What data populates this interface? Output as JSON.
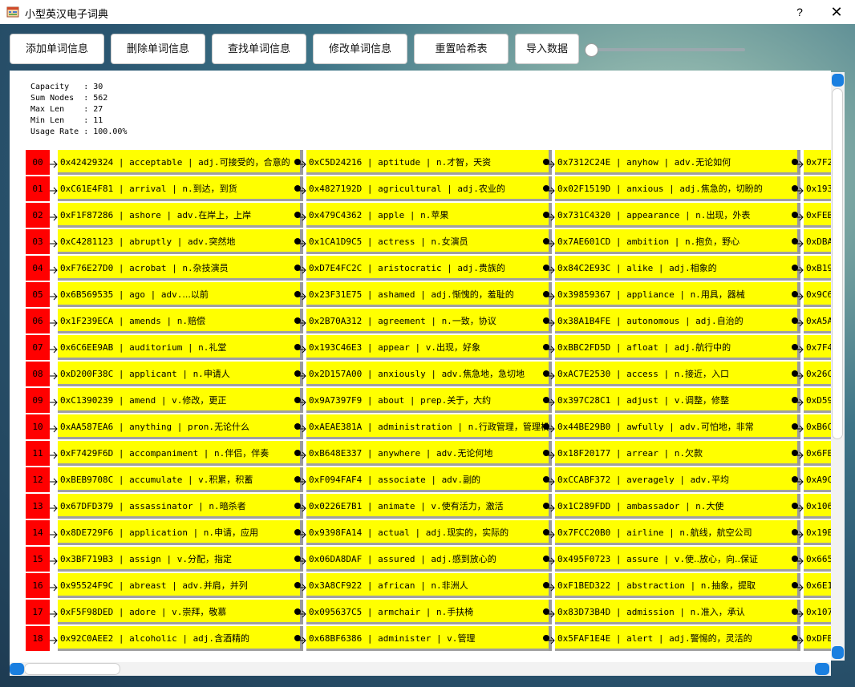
{
  "window": {
    "title": "小型英汉电子词典",
    "help": "?",
    "close": "✕"
  },
  "toolbar": {
    "buttons": [
      "添加单词信息",
      "删除单词信息",
      "查找单词信息",
      "修改单词信息",
      "重置哈希表",
      "导入数据"
    ],
    "slider_value": 0
  },
  "stats": {
    "capacity": "Capacity   : 30",
    "sum_nodes": "Sum Nodes  : 562",
    "max_len": "Max Len    : 27",
    "min_len": "Min Len    : 11",
    "usage_rate": "Usage Rate : 100.00%"
  },
  "colors": {
    "index_bg": "#ff0000",
    "cell_bg": "#ffff00",
    "accent": "#1a7fe0"
  },
  "rows": [
    {
      "idx": "00",
      "cells": [
        {
          "addr": "0x42429324",
          "word": "acceptable",
          "pos": "adj.",
          "meaning": "可接受的，合意的"
        },
        {
          "addr": "0xC5D24216",
          "word": "aptitude",
          "pos": "n.",
          "meaning": "才智，天资"
        },
        {
          "addr": "0x7312C24E",
          "word": "anyhow",
          "pos": "adv.",
          "meaning": "无论如何"
        },
        {
          "addr": "0x7F2",
          "word": "",
          "pos": "",
          "meaning": ""
        }
      ]
    },
    {
      "idx": "01",
      "cells": [
        {
          "addr": "0xC61E4F81",
          "word": "arrival",
          "pos": "n.",
          "meaning": "到达，到货"
        },
        {
          "addr": "0x4827192D",
          "word": "agricultural",
          "pos": "adj.",
          "meaning": "农业的"
        },
        {
          "addr": "0x02F1519D",
          "word": "anxious",
          "pos": "adj.",
          "meaning": "焦急的，切盼的"
        },
        {
          "addr": "0x193",
          "word": "",
          "pos": "",
          "meaning": ""
        }
      ]
    },
    {
      "idx": "02",
      "cells": [
        {
          "addr": "0xF1F87286",
          "word": "ashore",
          "pos": "adv.",
          "meaning": "在岸上，上岸"
        },
        {
          "addr": "0x479C4362",
          "word": "apple",
          "pos": "n.",
          "meaning": "苹果"
        },
        {
          "addr": "0x731C4320",
          "word": "appearance",
          "pos": "n.",
          "meaning": "出现，外表"
        },
        {
          "addr": "0xFEB",
          "word": "",
          "pos": "",
          "meaning": ""
        }
      ]
    },
    {
      "idx": "03",
      "cells": [
        {
          "addr": "0xC4281123",
          "word": "abruptly",
          "pos": "adv.",
          "meaning": "突然地"
        },
        {
          "addr": "0x1CA1D9C5",
          "word": "actress",
          "pos": "n.",
          "meaning": "女演员"
        },
        {
          "addr": "0x7AE601CD",
          "word": "ambition",
          "pos": "n.",
          "meaning": "抱负，野心"
        },
        {
          "addr": "0xDBA",
          "word": "",
          "pos": "",
          "meaning": ""
        }
      ]
    },
    {
      "idx": "04",
      "cells": [
        {
          "addr": "0xF76E27D0",
          "word": "acrobat",
          "pos": "n.",
          "meaning": "杂技演员"
        },
        {
          "addr": "0xD7E4FC2C",
          "word": "aristocratic",
          "pos": "adj.",
          "meaning": "贵族的"
        },
        {
          "addr": "0x84C2E93C",
          "word": "alike",
          "pos": "adj.",
          "meaning": "相象的"
        },
        {
          "addr": "0xB19",
          "word": "",
          "pos": "",
          "meaning": ""
        }
      ]
    },
    {
      "idx": "05",
      "cells": [
        {
          "addr": "0x6B569535",
          "word": "ago",
          "pos": "adv.",
          "meaning": "...以前"
        },
        {
          "addr": "0x23F31E75",
          "word": "ashamed",
          "pos": "adj.",
          "meaning": "惭愧的，羞耻的"
        },
        {
          "addr": "0x39859367",
          "word": "appliance",
          "pos": "n.",
          "meaning": "用具，器械"
        },
        {
          "addr": "0x9C6",
          "word": "",
          "pos": "",
          "meaning": ""
        }
      ]
    },
    {
      "idx": "06",
      "cells": [
        {
          "addr": "0x1F239ECA",
          "word": "amends",
          "pos": "n.",
          "meaning": "赔偿"
        },
        {
          "addr": "0x2B70A312",
          "word": "agreement",
          "pos": "n.",
          "meaning": "一致，协议"
        },
        {
          "addr": "0x38A1B4FE",
          "word": "autonomous",
          "pos": "adj.",
          "meaning": "自治的"
        },
        {
          "addr": "0xA5A",
          "word": "",
          "pos": "",
          "meaning": ""
        }
      ]
    },
    {
      "idx": "07",
      "cells": [
        {
          "addr": "0x6C6EE9AB",
          "word": "auditorium",
          "pos": "n.",
          "meaning": "礼堂"
        },
        {
          "addr": "0x193C46E3",
          "word": "appear",
          "pos": "v.",
          "meaning": "出现，好象"
        },
        {
          "addr": "0xBBC2FD5D",
          "word": "afloat",
          "pos": "adj.",
          "meaning": "航行中的"
        },
        {
          "addr": "0x7F4",
          "word": "",
          "pos": "",
          "meaning": ""
        }
      ]
    },
    {
      "idx": "08",
      "cells": [
        {
          "addr": "0xD200F38C",
          "word": "applicant",
          "pos": "n.",
          "meaning": "申请人"
        },
        {
          "addr": "0x2D157A00",
          "word": "anxiously",
          "pos": "adv.",
          "meaning": "焦急地，急切地"
        },
        {
          "addr": "0xAC7E2530",
          "word": "access",
          "pos": "n.",
          "meaning": "接近，入口"
        },
        {
          "addr": "0x26C",
          "word": "",
          "pos": "",
          "meaning": ""
        }
      ]
    },
    {
      "idx": "09",
      "cells": [
        {
          "addr": "0xC1390239",
          "word": "amend",
          "pos": "v.",
          "meaning": "修改，更正"
        },
        {
          "addr": "0x9A7397F9",
          "word": "about",
          "pos": "prep.",
          "meaning": "关于，大约"
        },
        {
          "addr": "0x397C28C1",
          "word": "adjust",
          "pos": "v.",
          "meaning": "调整，修整"
        },
        {
          "addr": "0xD59",
          "word": "",
          "pos": "",
          "meaning": ""
        }
      ]
    },
    {
      "idx": "10",
      "cells": [
        {
          "addr": "0xAA587EA6",
          "word": "anything",
          "pos": "pron.",
          "meaning": "无论什么"
        },
        {
          "addr": "0xAEAE381A",
          "word": "administration",
          "pos": "n.",
          "meaning": "行政管理，管理机关"
        },
        {
          "addr": "0x44BE29B0",
          "word": "awfully",
          "pos": "adv.",
          "meaning": "可怕地，非常"
        },
        {
          "addr": "0xB6C",
          "word": "",
          "pos": "",
          "meaning": ""
        }
      ]
    },
    {
      "idx": "11",
      "cells": [
        {
          "addr": "0xF7429F6D",
          "word": "accompaniment",
          "pos": "n.",
          "meaning": "伴侣，伴奏"
        },
        {
          "addr": "0xB648E337",
          "word": "anywhere",
          "pos": "adv.",
          "meaning": "无论何地"
        },
        {
          "addr": "0x18F20177",
          "word": "arrear",
          "pos": "n.",
          "meaning": "欠款"
        },
        {
          "addr": "0x6FE",
          "word": "",
          "pos": "",
          "meaning": ""
        }
      ]
    },
    {
      "idx": "12",
      "cells": [
        {
          "addr": "0xBEB9708C",
          "word": "accumulate",
          "pos": "v.",
          "meaning": "积累，积蓄"
        },
        {
          "addr": "0xF094FAF4",
          "word": "associate",
          "pos": "adv.",
          "meaning": "副的"
        },
        {
          "addr": "0xCCABF372",
          "word": "averagely",
          "pos": "adv.",
          "meaning": "平均"
        },
        {
          "addr": "0xA9C",
          "word": "",
          "pos": "",
          "meaning": ""
        }
      ]
    },
    {
      "idx": "13",
      "cells": [
        {
          "addr": "0x67DFD379",
          "word": "assassinator",
          "pos": "n.",
          "meaning": "暗杀者"
        },
        {
          "addr": "0x0226E7B1",
          "word": "animate",
          "pos": "v.",
          "meaning": "使有活力，激活"
        },
        {
          "addr": "0x1C289FDD",
          "word": "ambassador",
          "pos": "n.",
          "meaning": "大使"
        },
        {
          "addr": "0x106",
          "word": "",
          "pos": "",
          "meaning": ""
        }
      ]
    },
    {
      "idx": "14",
      "cells": [
        {
          "addr": "0x8DE729F6",
          "word": "application",
          "pos": "n.",
          "meaning": "申请，应用"
        },
        {
          "addr": "0x9398FA14",
          "word": "actual",
          "pos": "adj.",
          "meaning": "现实的，实际的"
        },
        {
          "addr": "0x7FCC20B0",
          "word": "airline",
          "pos": "n.",
          "meaning": "航线，航空公司"
        },
        {
          "addr": "0x19E",
          "word": "",
          "pos": "",
          "meaning": ""
        }
      ]
    },
    {
      "idx": "15",
      "cells": [
        {
          "addr": "0x3BF719B3",
          "word": "assign",
          "pos": "v.",
          "meaning": "分配，指定"
        },
        {
          "addr": "0x06DA8DAF",
          "word": "assured",
          "pos": "adj.",
          "meaning": "感到放心的"
        },
        {
          "addr": "0x495F0723",
          "word": "assure",
          "pos": "v.",
          "meaning": "使..放心，向..保证"
        },
        {
          "addr": "0x665",
          "word": "",
          "pos": "",
          "meaning": ""
        }
      ]
    },
    {
      "idx": "16",
      "cells": [
        {
          "addr": "0x95524F9C",
          "word": "abreast",
          "pos": "adv.",
          "meaning": "并肩，并列"
        },
        {
          "addr": "0x3A8CF922",
          "word": "african",
          "pos": "n.",
          "meaning": "非洲人"
        },
        {
          "addr": "0xF1BED322",
          "word": "abstraction",
          "pos": "n.",
          "meaning": "抽象，提取"
        },
        {
          "addr": "0x6E1",
          "word": "",
          "pos": "",
          "meaning": ""
        }
      ]
    },
    {
      "idx": "17",
      "cells": [
        {
          "addr": "0xF5F98DED",
          "word": "adore",
          "pos": "v.",
          "meaning": "崇拜，敬慕"
        },
        {
          "addr": "0x095637C5",
          "word": "armchair",
          "pos": "n.",
          "meaning": "手扶椅"
        },
        {
          "addr": "0x83D73B4D",
          "word": "admission",
          "pos": "n.",
          "meaning": "准入，承认"
        },
        {
          "addr": "0x107",
          "word": "",
          "pos": "",
          "meaning": ""
        }
      ]
    },
    {
      "idx": "18",
      "cells": [
        {
          "addr": "0x92C0AEE2",
          "word": "alcoholic",
          "pos": "adj.",
          "meaning": "含酒精的"
        },
        {
          "addr": "0x68BF6386",
          "word": "administer",
          "pos": "v.",
          "meaning": "管理"
        },
        {
          "addr": "0x5FAF1E4E",
          "word": "alert",
          "pos": "adj.",
          "meaning": "警惕的，灵活的"
        },
        {
          "addr": "0xDFE",
          "word": "",
          "pos": "",
          "meaning": ""
        }
      ]
    }
  ]
}
